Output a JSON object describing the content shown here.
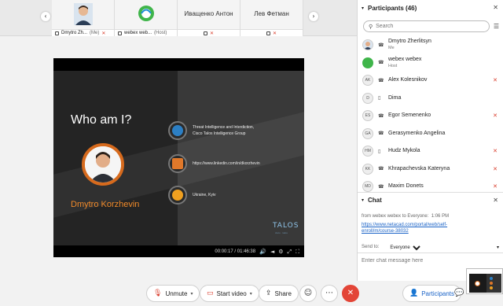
{
  "strip": {
    "tiles": [
      {
        "name": "Dmytro Zh...",
        "role": "(Me)"
      },
      {
        "name": "webex web...",
        "role": "(Host)"
      },
      {
        "name": "Иващенко Антон"
      },
      {
        "name": "Лев Фетман"
      }
    ]
  },
  "slide": {
    "title": "Who am I?",
    "speaker": "Dmytro Korzhevin",
    "info": [
      {
        "icon": "threat-intel-icon",
        "line1": "Threat Intelligence and Interdiction,",
        "line2": "Cisco Talos Intelligence Group"
      },
      {
        "icon": "briefcase-icon",
        "line1": "https://www.linkedin.com/in/dkorzhevin",
        "line2": ""
      },
      {
        "icon": "location-pin-icon",
        "line1": "Ukraine, Kyiv",
        "line2": ""
      }
    ],
    "brand": "TALOS",
    "brand_sub": "cisco · talos"
  },
  "video": {
    "time": "00:00:17 / 01:46:38"
  },
  "controls": {
    "unmute": "Unmute",
    "start_video": "Start video",
    "share": "Share"
  },
  "participants": {
    "title": "Participants (46)",
    "search_placeholder": "Search",
    "list": [
      {
        "initials": "",
        "name": "Dmytro Zherlitsyn",
        "sub": "Me",
        "device": "☎",
        "muted": false,
        "photo": true
      },
      {
        "initials": "",
        "name": "webex webex",
        "sub": "Host",
        "device": "☎",
        "muted": false,
        "webex": true
      },
      {
        "initials": "AK",
        "name": "Alex Kolesnikov",
        "device": "☎",
        "muted": true
      },
      {
        "initials": "D",
        "name": "Dima",
        "device": "▯",
        "muted": false
      },
      {
        "initials": "ES",
        "name": "Egor Semenenko",
        "device": "☎",
        "muted": true
      },
      {
        "initials": "GA",
        "name": "Gerasymenko Angelina",
        "device": "☎",
        "muted": false
      },
      {
        "initials": "HM",
        "name": "Hudz Mykola",
        "device": "▯",
        "muted": true
      },
      {
        "initials": "KK",
        "name": "Khrapachevska Kateryna",
        "device": "☎",
        "muted": true
      },
      {
        "initials": "MD",
        "name": "Maxim Donets",
        "device": "☎",
        "muted": true
      }
    ]
  },
  "chat": {
    "title": "Chat",
    "from": "from webex webex to Everyone:",
    "time": "1:06 PM",
    "link": "https://www.netacad.com/portal/web/self-enroll/m/course-38032",
    "send_to_label": "Send to:",
    "send_to_value": "Everyone",
    "input_placeholder": "Enter chat message here"
  },
  "right_controls": {
    "participants": "Participants"
  },
  "colors": {
    "accent_orange": "#f08a2a",
    "mute_red": "#d93c2b",
    "end_call_red": "#e34537",
    "link_blue": "#1a63c7"
  }
}
